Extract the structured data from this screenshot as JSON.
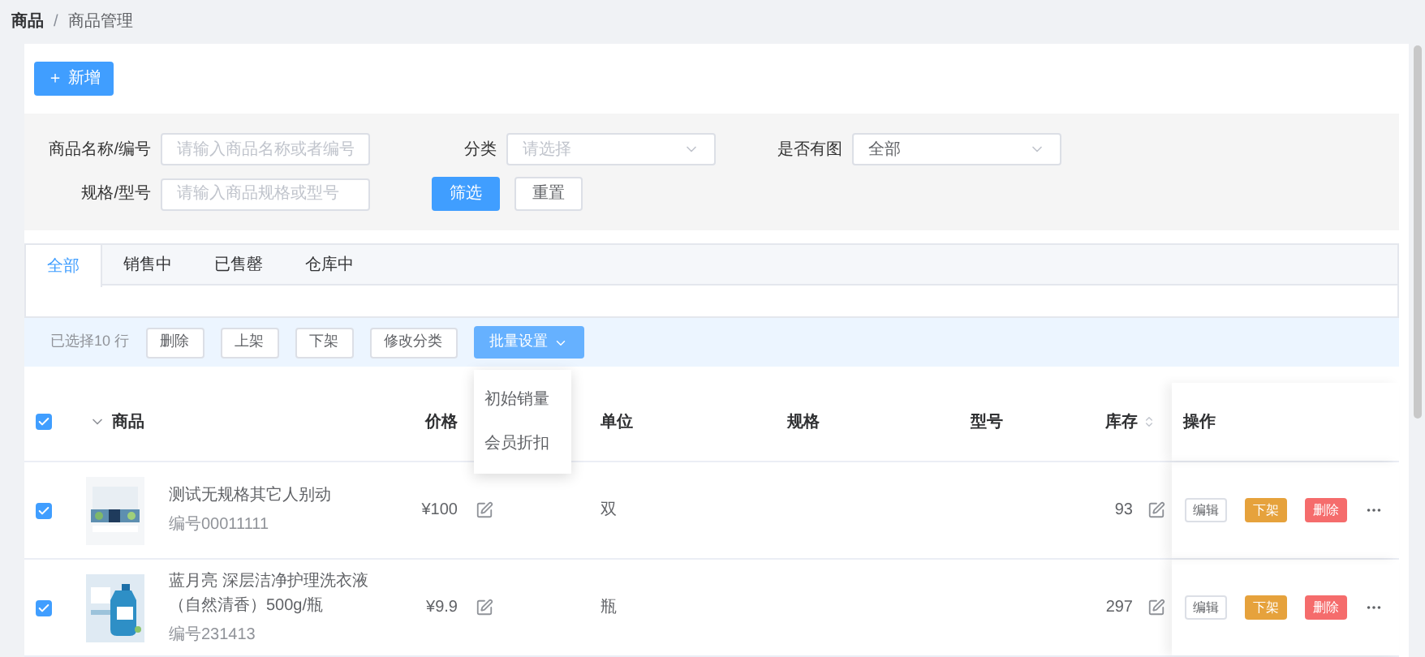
{
  "breadcrumb": [
    {
      "label": "商品",
      "current": false
    },
    {
      "label": "商品管理",
      "current": true
    }
  ],
  "breadcrumb_separator": "/",
  "add_button": {
    "icon": "＋",
    "label": "新增"
  },
  "filters": [
    {
      "kind": "input",
      "label": "商品名称/编号",
      "placeholder": "请输入商品名称或者编号"
    },
    {
      "kind": "select",
      "label": "分类",
      "placeholder": "请选择"
    },
    {
      "kind": "select",
      "label": "是否有图",
      "value": "全部"
    },
    {
      "kind": "input",
      "label": "规格/型号",
      "placeholder": "请输入商品规格或型号"
    }
  ],
  "filter_buttons": [
    {
      "label": "筛选",
      "kind": "primary"
    },
    {
      "label": "重置",
      "kind": "default"
    }
  ],
  "tabs": [
    {
      "label": "全部",
      "selected": true
    },
    {
      "label": "销售中",
      "selected": false
    },
    {
      "label": "已售罄",
      "selected": false
    },
    {
      "label": "仓库中",
      "selected": false
    }
  ],
  "batch_bar": {
    "selected_text": "已选择10 行",
    "buttons": [
      "删除",
      "上架",
      "下架",
      "修改分类"
    ],
    "batch_settings": {
      "label": "批量设置",
      "expanded": true,
      "menu": [
        "初始销量",
        "会员折扣"
      ]
    }
  },
  "table": {
    "select_all_checked": true,
    "columns": [
      {
        "label": "商品"
      },
      {
        "label": "价格"
      },
      {
        "label": "单位"
      },
      {
        "label": "规格"
      },
      {
        "label": "型号"
      },
      {
        "label": "库存",
        "sortable": true
      },
      {
        "label": "操作"
      }
    ],
    "rows": [
      {
        "checked": true,
        "name": "测试无规格其它人别动",
        "code": "编号00011111",
        "price": "¥100",
        "unit": "双",
        "stock": "93",
        "actions": [
          {
            "label": "编辑",
            "kind": "outline"
          },
          {
            "label": "下架",
            "kind": "warning"
          },
          {
            "label": "删除",
            "kind": "danger"
          }
        ]
      },
      {
        "checked": true,
        "name": "蓝月亮 深层洁净护理洗衣液（自然清香）500g/瓶",
        "code": "编号231413",
        "price": "¥9.9",
        "unit": "瓶",
        "stock": "297",
        "actions": [
          {
            "label": "编辑",
            "kind": "outline"
          },
          {
            "label": "下架",
            "kind": "warning"
          },
          {
            "label": "删除",
            "kind": "danger"
          }
        ]
      }
    ]
  }
}
